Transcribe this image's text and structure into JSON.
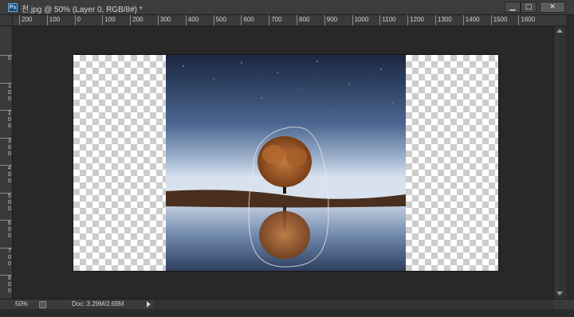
{
  "window": {
    "title": "천.jpg @ 50% (Layer 0, RGB/8#) *",
    "app_icon_label": "Ps",
    "controls": {
      "minimize_glyph": "▁",
      "maximize_glyph": "□",
      "close_glyph": "✕"
    }
  },
  "ruler": {
    "horizontal": [
      "200",
      "100",
      "0",
      "100",
      "200",
      "300",
      "400",
      "500",
      "600",
      "700",
      "800",
      "900",
      "1000",
      "1100",
      "1200",
      "1300",
      "1400",
      "1500",
      "1600"
    ],
    "vertical": [
      "0",
      "100",
      "200",
      "300",
      "400",
      "500",
      "600",
      "700",
      "800"
    ]
  },
  "status": {
    "zoom": "50%",
    "doc_info": "Doc: 3.29M/2.69M"
  },
  "icons": {
    "app": "photoshop-icon",
    "status": "proof-icon",
    "menu": "triangle-right-icon"
  },
  "colors": {
    "workspace": "#282828",
    "chrome": "#3c3c3c",
    "sky_top": "#1d2a45",
    "sky_bottom": "#b9c6d8"
  }
}
